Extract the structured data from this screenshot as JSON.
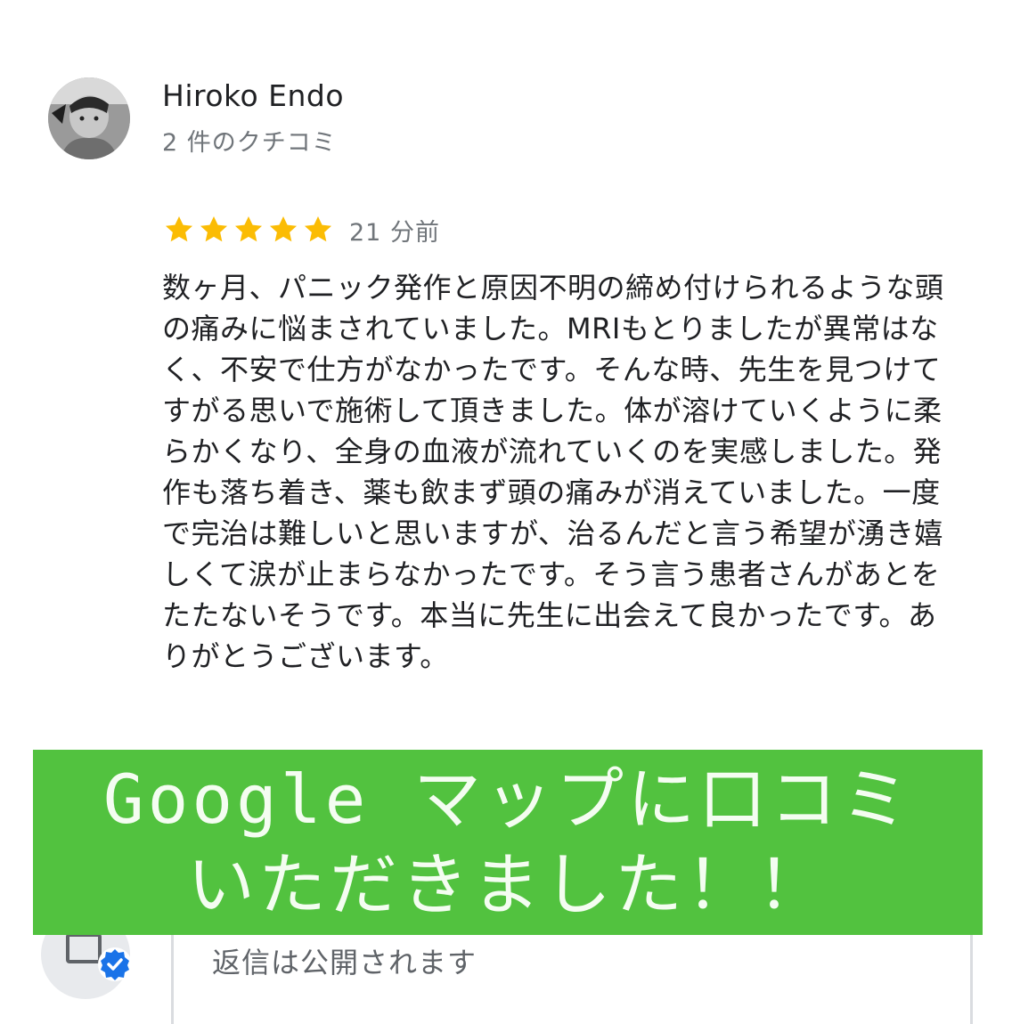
{
  "reviewer": {
    "name": "Hiroko Endo",
    "review_count": "2 件のクチコミ"
  },
  "review": {
    "rating": 5,
    "max_rating": 5,
    "star_color": "#fbbc04",
    "time_ago": "21 分前",
    "text": "数ヶ月、パニック発作と原因不明の締め付けられるような頭の痛みに悩まされていました。MRIもとりましたが異常はなく、不安で仕方がなかったです。そんな時、先生を見つけてすがる思いで施術して頂きました。体が溶けていくように柔らかくなり、全身の血液が流れていくのを実感しました。発作も落ち着き、薬も飲まず頭の痛みが消えていました。一度で完治は難しいと思いますが、治るんだと言う希望が湧き嬉しくて涙が止まらなかったです。そう言う患者さんがあとをたたないそうです。本当に先生に出会えて良かったです。ありがとうございます。"
  },
  "banner": {
    "line1": "Google マップに口コミ",
    "line2": "いただきました！！",
    "background": "#52c23f"
  },
  "reply": {
    "placeholder": "返信は公開されます",
    "verified_badge_color": "#1a73e8"
  },
  "icons": {
    "avatar": "user-photo",
    "star": "star-icon",
    "owner": "store-icon",
    "verified": "verified-check-icon"
  }
}
